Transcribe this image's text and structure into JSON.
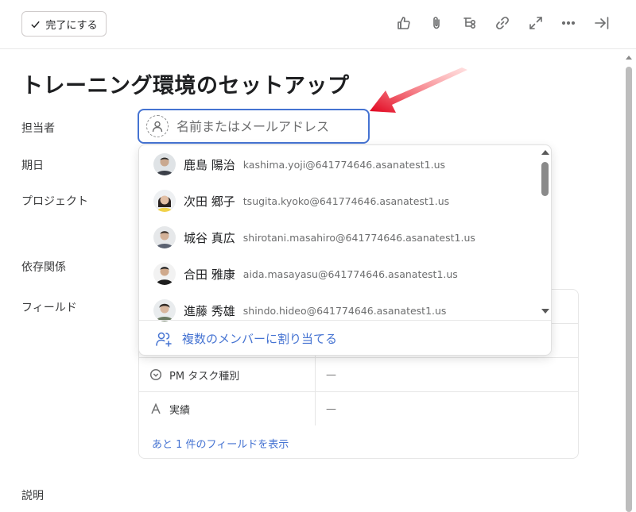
{
  "toolbar": {
    "complete_label": "完了にする"
  },
  "task": {
    "title": "トレーニング環境のセットアップ"
  },
  "labels": {
    "assignee": "担当者",
    "due_date": "期日",
    "projects": "プロジェクト",
    "dependencies": "依存関係",
    "fields": "フィールド",
    "description": "説明"
  },
  "assignee_input": {
    "placeholder": "名前またはメールアドレス"
  },
  "dropdown": {
    "users": [
      {
        "name": "鹿島 陽治",
        "email": "kashima.yoji@641774646.asanatest1.us"
      },
      {
        "name": "次田 郷子",
        "email": "tsugita.kyoko@641774646.asanatest1.us"
      },
      {
        "name": "城谷 真広",
        "email": "shirotani.masahiro@641774646.asanatest1.us"
      },
      {
        "name": "合田 雅康",
        "email": "aida.masayasu@641774646.asanatest1.us"
      },
      {
        "name": "進藤 秀雄",
        "email": "shindo.hideo@641774646.asanatest1.us"
      }
    ],
    "assign_multiple": "複数のメンバーに割り当てる"
  },
  "fields": {
    "rows": [
      {
        "name": "PM タスク種別",
        "value": "—",
        "icon": "chevron-circle-icon"
      },
      {
        "name": "実績",
        "value": "—",
        "icon": "text-a-icon"
      }
    ],
    "show_more": "あと 1 件のフィールドを表示"
  }
}
